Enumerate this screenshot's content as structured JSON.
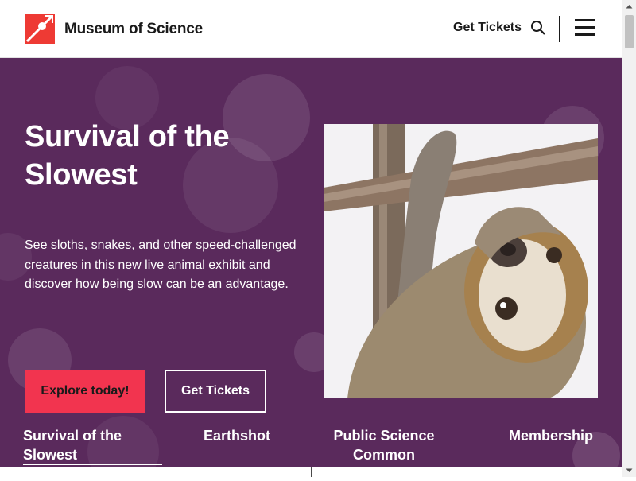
{
  "header": {
    "site_name": "Museum of Science",
    "get_tickets": "Get Tickets",
    "icons": {
      "search": "search-icon",
      "menu": "hamburger-menu-icon",
      "logo": "museum-logo-icon"
    },
    "brand_color": "#ee3a34"
  },
  "hero": {
    "title": "Survival of the Slowest",
    "description": "See sloths, snakes, and other speed-challenged creatures in this new live animal exhibit and discover how being slow can be an advantage.",
    "primary_button": "Explore today!",
    "secondary_button": "Get Tickets",
    "background_color": "#5a2a5c",
    "primary_button_color": "#f2344f"
  },
  "tabs": [
    {
      "label": "Survival of the Slowest",
      "active": true
    },
    {
      "label": "Earthshot",
      "active": false
    },
    {
      "label": "Public Science Common",
      "active": false
    },
    {
      "label": "Membership",
      "active": false
    }
  ]
}
